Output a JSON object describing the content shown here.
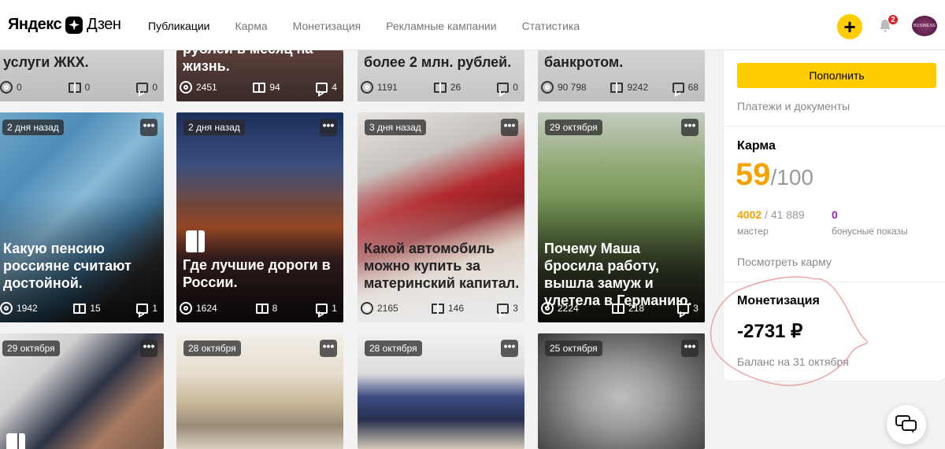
{
  "header": {
    "logo_left": "Яндекс",
    "logo_right": "Дзен",
    "nav": [
      "Публикации",
      "Карма",
      "Монетизация",
      "Рекламные кампании",
      "Статистика"
    ],
    "plus": "+",
    "notif_count": "2",
    "avatar_text": "BUSINESS"
  },
  "cards_top": [
    {
      "title": "услуги ЖКХ.",
      "views": "0",
      "reads": "0",
      "comments": "0"
    },
    {
      "title": "рублей в месяц на жизнь.",
      "views": "2451",
      "reads": "94",
      "comments": "4"
    },
    {
      "title": "более 2 млн. рублей.",
      "views": "1191",
      "reads": "26",
      "comments": "0"
    },
    {
      "title": "банкротом.",
      "views": "90 798",
      "reads": "9242",
      "comments": "68"
    }
  ],
  "cards_mid": [
    {
      "date": "2 дня назад",
      "title": "Какую пенсию россияне считают достойной.",
      "views": "1942",
      "reads": "15",
      "comments": "1"
    },
    {
      "date": "2 дня назад",
      "title": "Где лучшие дороги в России.",
      "views": "1624",
      "reads": "8",
      "comments": "1"
    },
    {
      "date": "3 дня назад",
      "title": "Какой автомобиль можно купить за материнский капитал.",
      "views": "2165",
      "reads": "146",
      "comments": "3"
    },
    {
      "date": "29 октября",
      "title": "Почему Маша бросила работу, вышла замуж и улетела в Германию.",
      "views": "2224",
      "reads": "218",
      "comments": "3"
    }
  ],
  "cards_bot": [
    {
      "date": "29 октября"
    },
    {
      "date": "28 октября"
    },
    {
      "date": "28 октября"
    },
    {
      "date": "25 октября"
    }
  ],
  "more": "•••",
  "sidebar": {
    "topup": "Пополнить",
    "payments": "Платежи и документы",
    "karma_title": "Карма",
    "karma_value": "59",
    "karma_max": "/100",
    "master_value": "4002",
    "master_total": "/ 41 889",
    "master_label": "мастер",
    "bonus_value": "0",
    "bonus_label": "бонусные показы",
    "karma_link": "Посмотреть карму",
    "monet_title": "Монетизация",
    "money": "-2731 ₽",
    "balance": "Баланс на 31 октября"
  }
}
